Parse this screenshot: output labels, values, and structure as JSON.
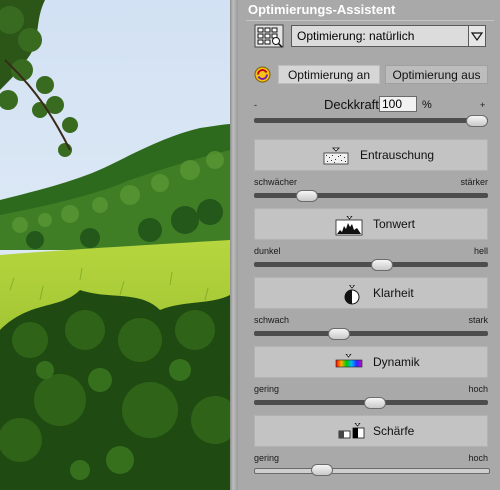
{
  "panel": {
    "title": "Optimierungs-Assistent",
    "preset": {
      "value": "Optimierung: natürlich",
      "icon": "preset-grid-icon"
    },
    "toggle": {
      "on_label": "Optimierung an",
      "off_label": "Optimierung aus",
      "active": "on"
    },
    "opacity": {
      "minus": "-",
      "plus": "+",
      "label": "Deckkraft",
      "value": "100",
      "unit": "%",
      "level_percent": 100
    },
    "sections": [
      {
        "id": "entrauschung",
        "label": "Entrauschung",
        "icon": "noise-icon",
        "low": "schwächer",
        "high": "stärker",
        "level_percent": 20
      },
      {
        "id": "tonwert",
        "label": "Tonwert",
        "icon": "histogram-icon",
        "low": "dunkel",
        "high": "hell",
        "level_percent": 55
      },
      {
        "id": "klarheit",
        "label": "Klarheit",
        "icon": "contrast-icon",
        "low": "schwach",
        "high": "stark",
        "level_percent": 35
      },
      {
        "id": "dynamik",
        "label": "Dynamik",
        "icon": "color-spectrum-icon",
        "low": "gering",
        "high": "hoch",
        "level_percent": 52
      },
      {
        "id": "schaerfe",
        "label": "Schärfe",
        "icon": "sharpness-icon",
        "low": "gering",
        "high": "hoch",
        "level_percent": 27
      }
    ]
  },
  "colors": {
    "panel_bg": "#a9a9a9",
    "section_bg": "#c3c3c3",
    "track": "#4d4d4d"
  }
}
